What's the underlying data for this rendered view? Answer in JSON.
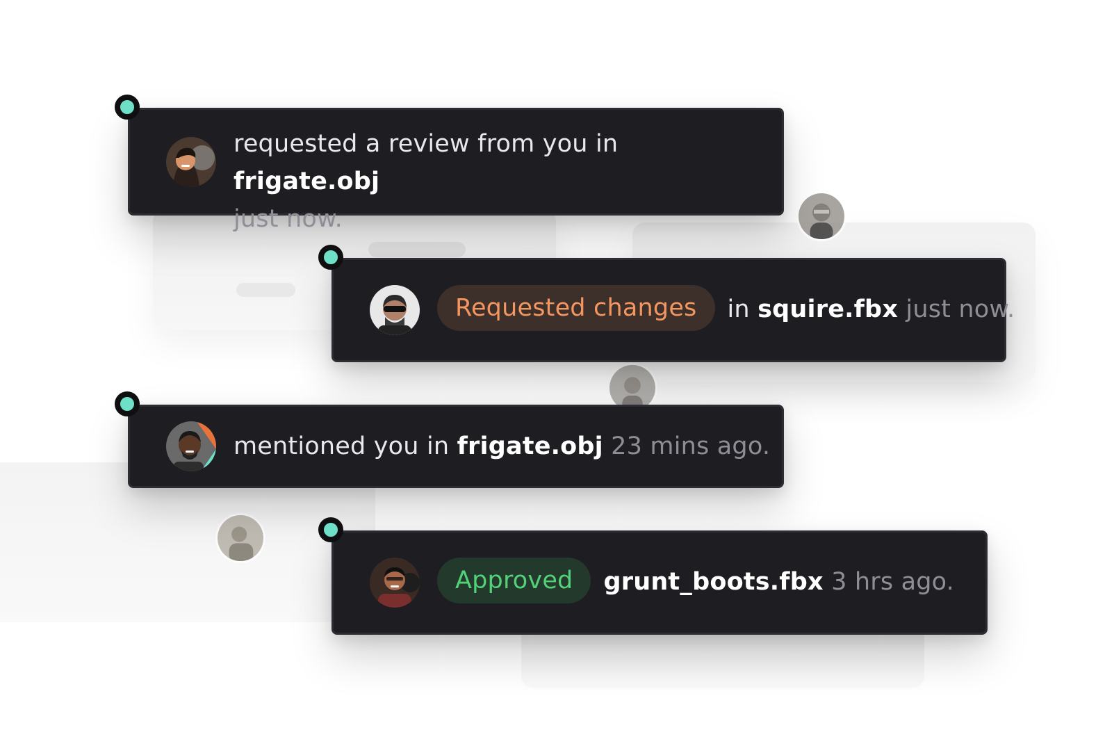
{
  "notifications": [
    {
      "action": "requested a review from you in",
      "file": "frigate.obj",
      "time": "just now.",
      "unread": true
    },
    {
      "status": "Requested changes",
      "status_color": "#f3965f",
      "prefix": "in",
      "file": "squire.fbx",
      "time": "just now.",
      "unread": true
    },
    {
      "action": "mentioned you in",
      "file": "frigate.obj",
      "time": "23 mins ago.",
      "unread": true
    },
    {
      "status": "Approved",
      "status_color": "#53d178",
      "file": "grunt_boots.fbx",
      "time": "3 hrs ago.",
      "unread": true
    }
  ],
  "colors": {
    "card_bg": "#1e1e22",
    "unread_dot": "#6fe0c8",
    "muted_text": "#8e8e96"
  },
  "icons": [
    "user-avatar",
    "unread-indicator"
  ]
}
